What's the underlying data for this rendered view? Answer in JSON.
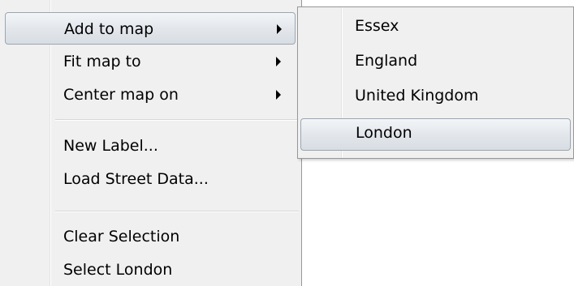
{
  "context_menu": {
    "items": [
      {
        "label": "Add to map",
        "has_submenu": true,
        "highlighted": true
      },
      {
        "label": "Fit map to",
        "has_submenu": true,
        "highlighted": false
      },
      {
        "label": "Center map on",
        "has_submenu": true,
        "highlighted": false
      },
      {
        "label": "New Label...",
        "has_submenu": false,
        "highlighted": false
      },
      {
        "label": "Load Street Data...",
        "has_submenu": false,
        "highlighted": false
      },
      {
        "label": "Clear Selection",
        "has_submenu": false,
        "highlighted": false
      },
      {
        "label": "Select London",
        "has_submenu": false,
        "highlighted": false
      }
    ]
  },
  "submenu": {
    "items": [
      {
        "label": "Essex",
        "highlighted": false
      },
      {
        "label": "England",
        "highlighted": false
      },
      {
        "label": "United Kingdom",
        "highlighted": false
      },
      {
        "label": "London",
        "highlighted": true
      }
    ]
  },
  "colors": {
    "menu_background": "#f0f0f0",
    "menu_border": "#979797",
    "highlight_border": "#9aa6b3",
    "text": "#000000"
  }
}
